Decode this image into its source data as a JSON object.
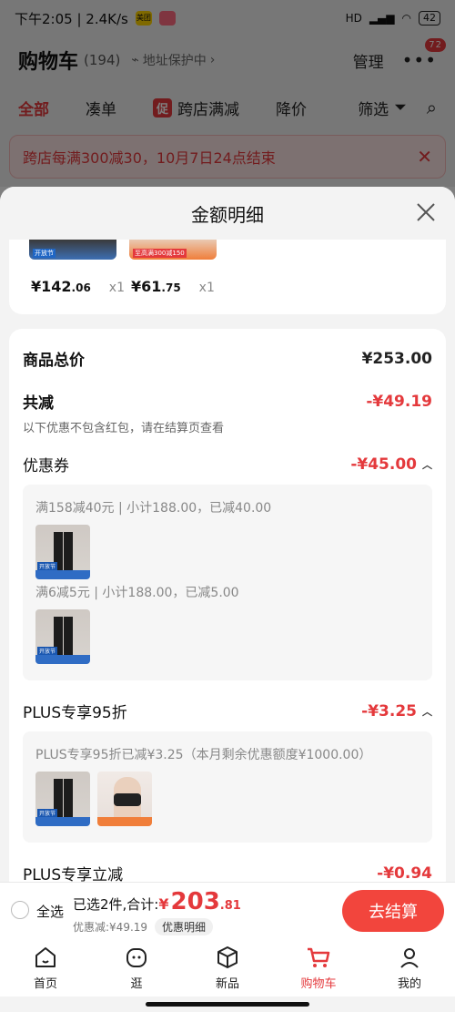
{
  "status_bar": {
    "time_speed": "下午2:05 | 2.4K/s",
    "app_badge": "美团",
    "signal": "HD",
    "battery": "42"
  },
  "cart": {
    "title": "购物车",
    "count": "(194)",
    "address": "地址保护中",
    "manage": "管理",
    "msg_badge": "72"
  },
  "tabs": [
    {
      "label": "全部",
      "active": true
    },
    {
      "label": "凑单"
    },
    {
      "label": "跨店满减",
      "tag": "促"
    },
    {
      "label": "降价"
    },
    {
      "label": "筛选"
    }
  ],
  "notice": {
    "text": "跨店每满300减30，10月7日24点结束"
  },
  "sheet": {
    "title": "金额明细",
    "products": [
      {
        "label": "开放节",
        "price_int": "¥142",
        "price_dec": ".06",
        "qty": "x1"
      },
      {
        "label": "至高满300减150",
        "price_int": "¥61",
        "price_dec": ".75",
        "qty": "x1"
      }
    ],
    "total": {
      "label": "商品总价",
      "value": "¥253.00"
    },
    "reduce": {
      "label": "共减",
      "value": "-¥49.19",
      "note": "以下优惠不包含红包，请在结算页查看"
    },
    "coupon": {
      "label": "优惠券",
      "value": "-¥45.00",
      "items": [
        {
          "text": "满158减40元 | 小计188.00，已减40.00"
        },
        {
          "text": "满6减5元 | 小计188.00，已减5.00"
        }
      ]
    },
    "plus95": {
      "label": "PLUS专享95折",
      "value": "-¥3.25",
      "desc": "PLUS专享95折已减¥3.25（本月剩余优惠额度¥1000.00）"
    },
    "plus_direct": {
      "label": "PLUS专享立减",
      "value": "-¥0.94"
    }
  },
  "checkout": {
    "select_all": "全选",
    "selected": "已选2件,合计:",
    "currency": "¥",
    "amount_int": "203",
    "amount_dec": ".81",
    "discount": "优惠减:¥49.19",
    "detail": "优惠明细",
    "pay": "去结算"
  },
  "tabbar": [
    {
      "label": "首页",
      "icon": "home-icon"
    },
    {
      "label": "逛",
      "icon": "face-icon"
    },
    {
      "label": "新品",
      "icon": "box-icon"
    },
    {
      "label": "购物车",
      "icon": "cart-icon",
      "active": true
    },
    {
      "label": "我的",
      "icon": "user-icon"
    }
  ]
}
